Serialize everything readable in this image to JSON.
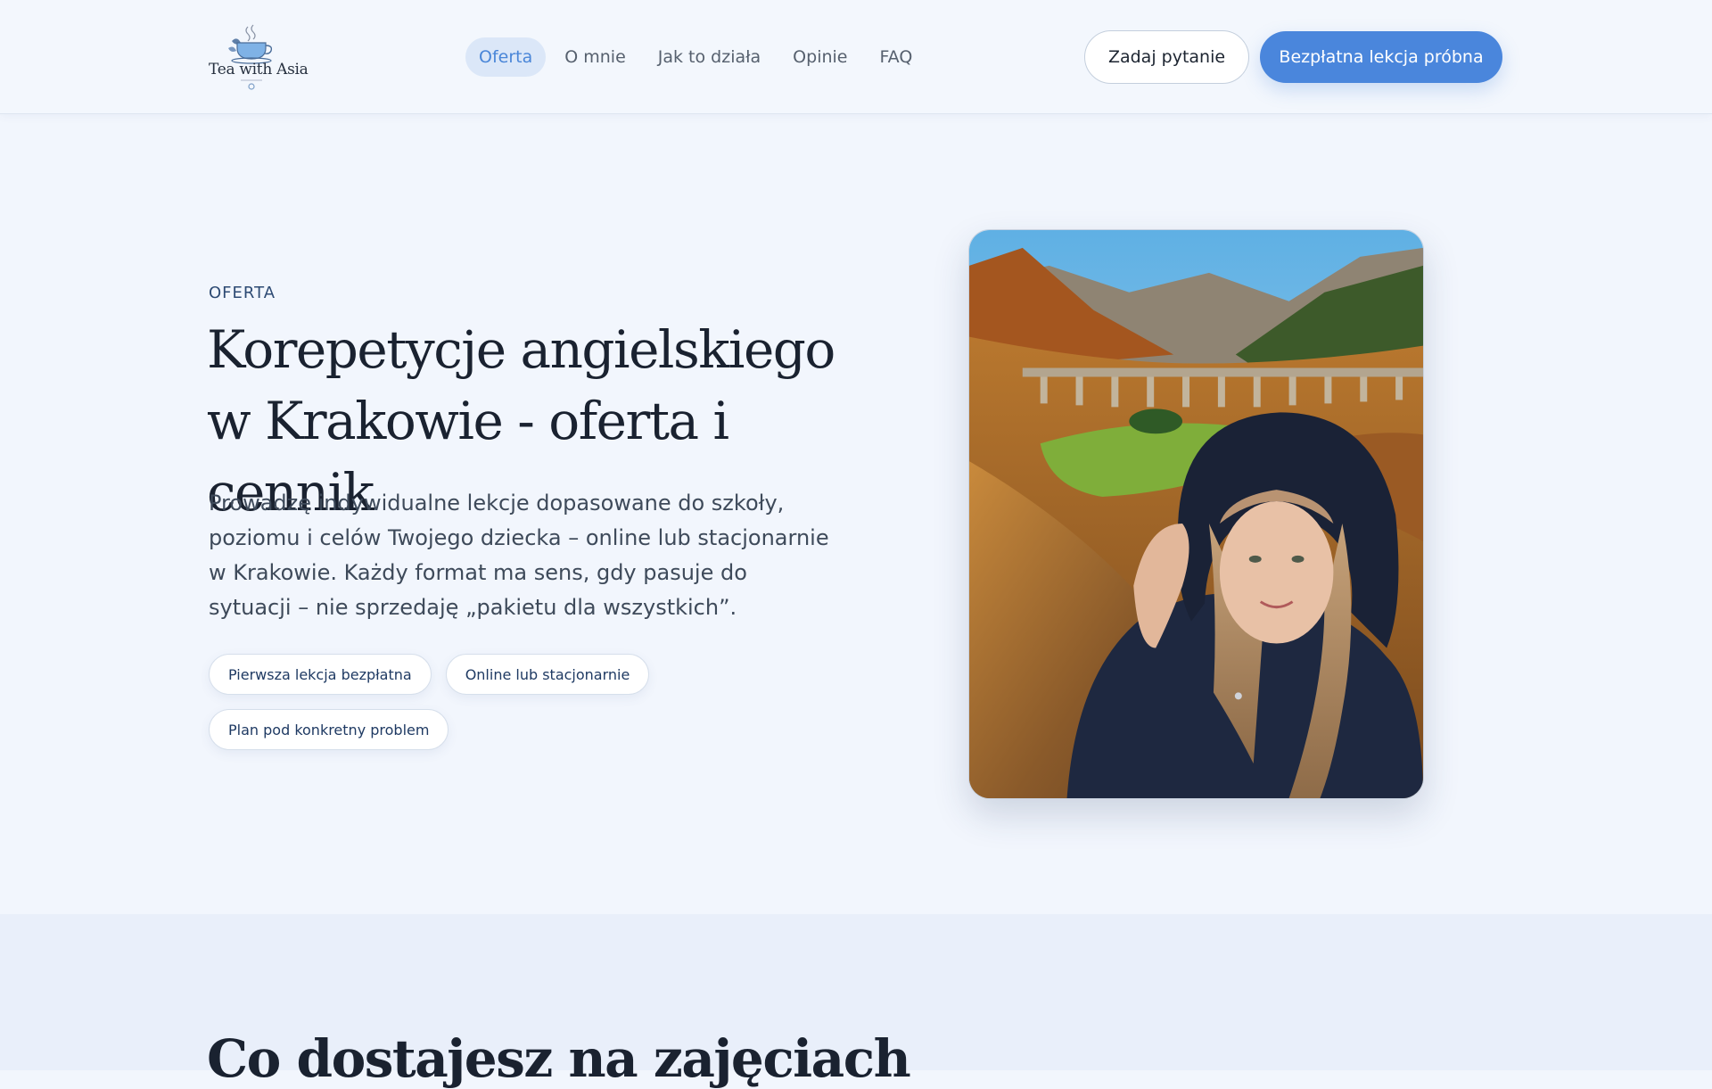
{
  "brand": {
    "logo_text": "Tea with Asia",
    "accent_color": "#4a86dc"
  },
  "nav": {
    "items": [
      {
        "label": "Oferta",
        "active": true
      },
      {
        "label": "O mnie",
        "active": false
      },
      {
        "label": "Jak to działa",
        "active": false
      },
      {
        "label": "Opinie",
        "active": false
      },
      {
        "label": "FAQ",
        "active": false
      }
    ]
  },
  "header": {
    "ask_button": "Zadaj pytanie",
    "trial_button": "Bezpłatna lekcja próbna"
  },
  "hero": {
    "eyebrow": "OFERTA",
    "title": "Korepetycje angielskiego w Krakowie - oferta i cennik",
    "description": "Prowadzę indywidualne lekcje dopasowane do szkoły, poziomu i celów Twojego dziecka – online lub stacjonarnie w Krakowie. Każdy format ma sens, gdy pasuje do sytuacji – nie sprzedaję „pakietu dla wszystkich”.",
    "chips": [
      "Pierwsza lekcja bezpłatna",
      "Online lub stacjonarnie",
      "Plan pod konkretny problem"
    ],
    "photo_icon": "portrait-photo"
  },
  "section2": {
    "title": "Co dostajesz na zajęciach"
  }
}
